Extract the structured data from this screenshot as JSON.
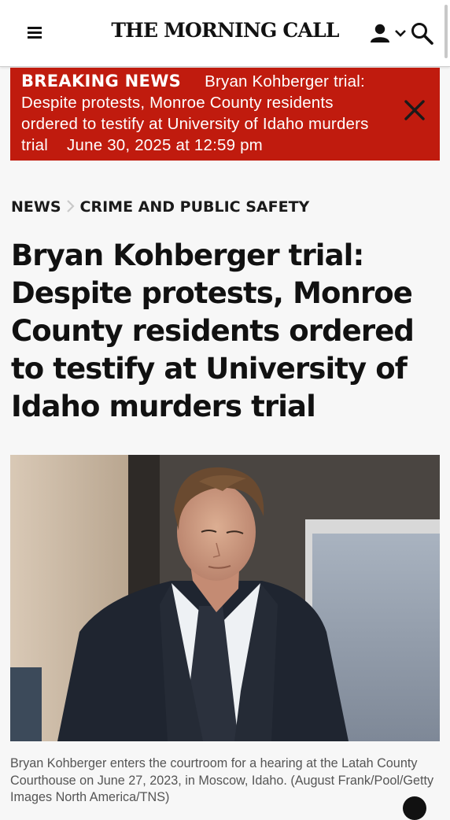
{
  "header": {
    "masthead": "THE MORNING CALL",
    "icons": [
      "menu-icon",
      "user-icon",
      "chevron-down-icon",
      "search-icon"
    ]
  },
  "breaking": {
    "label": "BREAKING NEWS",
    "text": "Bryan Kohberger trial: Despite protests, Monroe County residents ordered to testify at University of Idaho murders trial",
    "date": "June 30, 2025 at 12:59 pm",
    "background_color": "#c01b0e",
    "close_icon": "close-icon"
  },
  "breadcrumb": {
    "section": "NEWS",
    "subsection": "CRIME AND PUBLIC SAFETY",
    "separator_icon": "chevron-right-icon"
  },
  "article": {
    "headline": "Bryan Kohberger trial: Despite protests, Monroe County residents ordered to testify at University of Idaho murders trial",
    "caption": "Bryan Kohberger enters the courtroom for a hearing at the Latah County Courthouse on June 27, 2023, in Moscow, Idaho. (August Frank/Pool/Getty Images North America/TNS)"
  }
}
